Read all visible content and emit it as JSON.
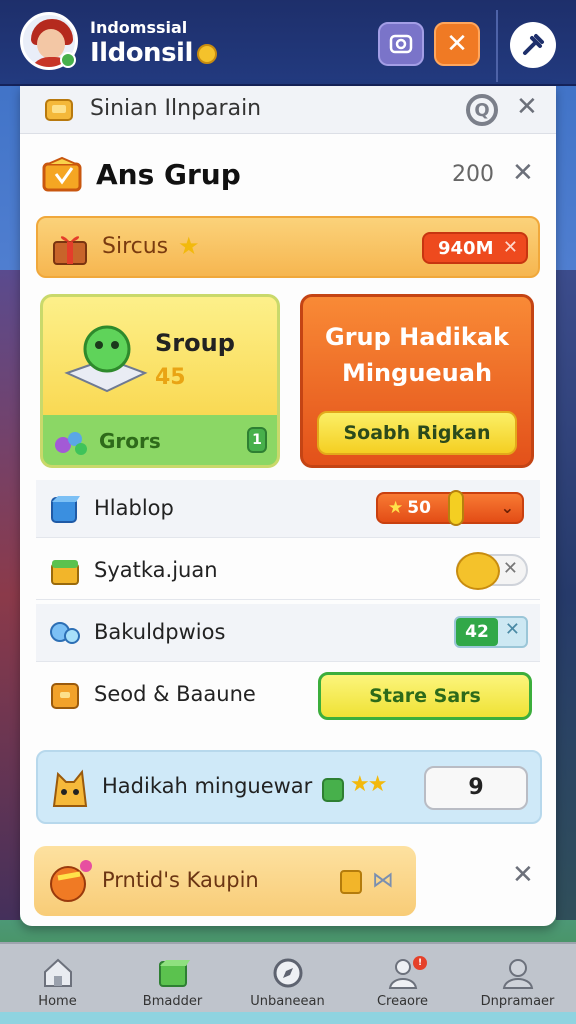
{
  "header": {
    "subtitle": "Indomssial",
    "username": "Ildonsil",
    "buttons": {
      "camera": "camera-icon",
      "close": "✕",
      "tools": "tools-icon"
    }
  },
  "search": {
    "text": "Sinian Ilnparain",
    "close": "✕"
  },
  "group": {
    "title": "Ans Grup",
    "count": "200",
    "close": "✕"
  },
  "status": {
    "label": "Sircus",
    "badge": "940M",
    "badge_close": "✕"
  },
  "card_left": {
    "title": "Sroup",
    "value": "45",
    "footer": "Grors",
    "lock": "1"
  },
  "card_right": {
    "title_line1": "Grup Hadikak",
    "title_line2": "Mingueuah",
    "button": "Soabh Rigkan"
  },
  "list": [
    {
      "label": "Hlablop",
      "value": "50"
    },
    {
      "label": "Syatka.juan",
      "value": ""
    },
    {
      "label": "Bakuldpwios",
      "value": "42"
    },
    {
      "label": "Seod & Baaune",
      "button": "Stare Sars"
    }
  ],
  "banner_blue": {
    "label": "Hadikah minguewar",
    "value": "9"
  },
  "banner_orange": {
    "label": "Prntid's Kaupin",
    "close": "✕"
  },
  "bottom_nav": [
    {
      "label": "Home",
      "icon": "home-icon"
    },
    {
      "label": "Bmadder",
      "icon": "cube-icon"
    },
    {
      "label": "Unbaneean",
      "icon": "compass-icon"
    },
    {
      "label": "Creaore",
      "icon": "person-icon",
      "badge": "!"
    },
    {
      "label": "Dnpramaer",
      "icon": "profile-icon"
    }
  ],
  "colors": {
    "accent_orange": "#e3511a",
    "accent_green": "#31a848",
    "header_navy": "#1e2f6b",
    "gold": "#f4c22b"
  }
}
